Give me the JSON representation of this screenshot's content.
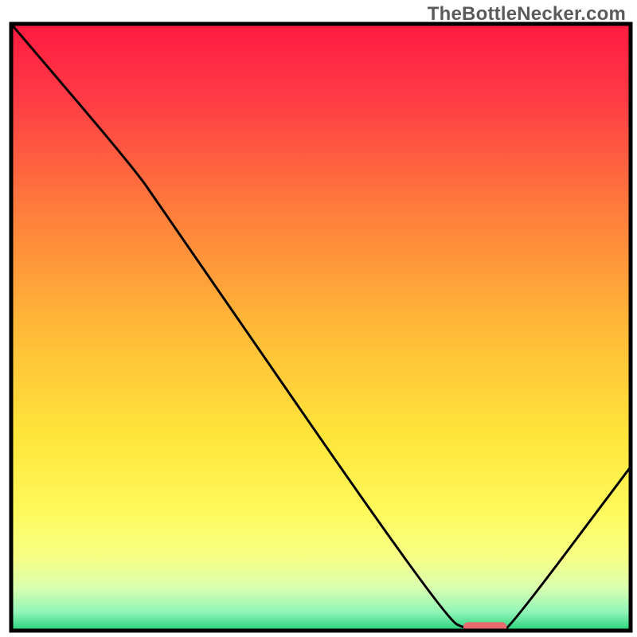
{
  "watermark": "TheBottleNecker.com",
  "chart_data": {
    "type": "line",
    "title": "",
    "xlabel": "",
    "ylabel": "",
    "xlim": [
      0,
      100
    ],
    "ylim": [
      0,
      100
    ],
    "curve": [
      {
        "x": 0,
        "y": 100
      },
      {
        "x": 20,
        "y": 76
      },
      {
        "x": 24,
        "y": 70
      },
      {
        "x": 70,
        "y": 2
      },
      {
        "x": 74,
        "y": 0
      },
      {
        "x": 79,
        "y": 0
      },
      {
        "x": 80.5,
        "y": 0.5
      },
      {
        "x": 100,
        "y": 27
      }
    ],
    "valley_marker": {
      "x_start": 73,
      "x_end": 80,
      "y": 0.6
    },
    "gradient_stops": [
      {
        "offset": 0,
        "color": "#ff1a40"
      },
      {
        "offset": 0.12,
        "color": "#ff3a46"
      },
      {
        "offset": 0.3,
        "color": "#ff7a3c"
      },
      {
        "offset": 0.5,
        "color": "#ffb938"
      },
      {
        "offset": 0.68,
        "color": "#ffe53a"
      },
      {
        "offset": 0.8,
        "color": "#fff95a"
      },
      {
        "offset": 0.88,
        "color": "#f7ff86"
      },
      {
        "offset": 0.93,
        "color": "#d9ffb0"
      },
      {
        "offset": 0.97,
        "color": "#8ff5b7"
      },
      {
        "offset": 1.0,
        "color": "#25d07a"
      }
    ],
    "frame_color": "#000000",
    "frame_width": 5,
    "curve_color": "#000000",
    "curve_width": 3,
    "marker_color": "#e96a6d"
  }
}
